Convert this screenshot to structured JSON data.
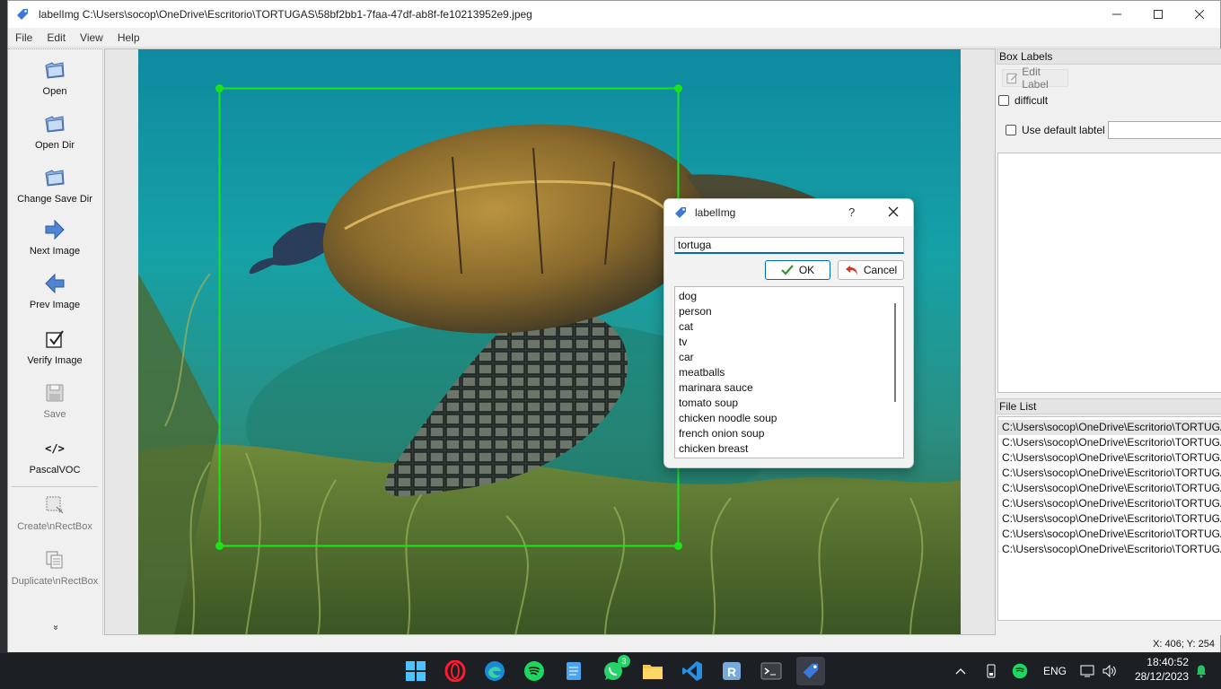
{
  "window": {
    "title": "labelImg C:\\Users\\socop\\OneDrive\\Escritorio\\TORTUGAS\\58bf2bb1-7faa-47df-ab8f-fe10213952e9.jpeg"
  },
  "menu": [
    "File",
    "Edit",
    "View",
    "Help"
  ],
  "toolbar": {
    "open": "Open",
    "open_dir": "Open Dir",
    "change_save_dir": "Change Save Dir",
    "next_image": "Next Image",
    "prev_image": "Prev Image",
    "verify_image": "Verify Image",
    "save": "Save",
    "format_icon_text": "</>",
    "format": "PascalVOC",
    "create_rect": "Create\\nRectBox",
    "duplicate_rect": "Duplicate\\nRectBox",
    "more": "»"
  },
  "dock": {
    "box_labels_title": "Box Labels",
    "edit_label": "Edit Label",
    "difficult": "difficult",
    "use_default_label": "Use default labtel",
    "file_list_title": "File List",
    "files": [
      "C:\\Users\\socop\\OneDrive\\Escritorio\\TORTUGAS\\",
      "C:\\Users\\socop\\OneDrive\\Escritorio\\TORTUGAS\\",
      "C:\\Users\\socop\\OneDrive\\Escritorio\\TORTUGAS\\",
      "C:\\Users\\socop\\OneDrive\\Escritorio\\TORTUGAS\\",
      "C:\\Users\\socop\\OneDrive\\Escritorio\\TORTUGAS\\",
      "C:\\Users\\socop\\OneDrive\\Escritorio\\TORTUGAS\\",
      "C:\\Users\\socop\\OneDrive\\Escritorio\\TORTUGAS\\",
      "C:\\Users\\socop\\OneDrive\\Escritorio\\TORTUGAS\\",
      "C:\\Users\\socop\\OneDrive\\Escritorio\\TORTUGAS\\"
    ]
  },
  "status": {
    "coords": "X: 406; Y: 254"
  },
  "dialog": {
    "title": "labelImg",
    "help": "?",
    "input_value": "tortuga",
    "ok": "OK",
    "cancel": "Cancel",
    "labels": [
      "dog",
      "person",
      "cat",
      "tv",
      "car",
      "meatballs",
      "marinara sauce",
      "tomato soup",
      "chicken noodle soup",
      "french onion soup",
      "chicken breast"
    ]
  },
  "taskbar": {
    "whatsapp_badge": "3",
    "lang": "ENG",
    "time": "18:40:52",
    "date": "28/12/2023"
  },
  "colors": {
    "bbox": "#19e619",
    "accent": "#0067c0"
  }
}
